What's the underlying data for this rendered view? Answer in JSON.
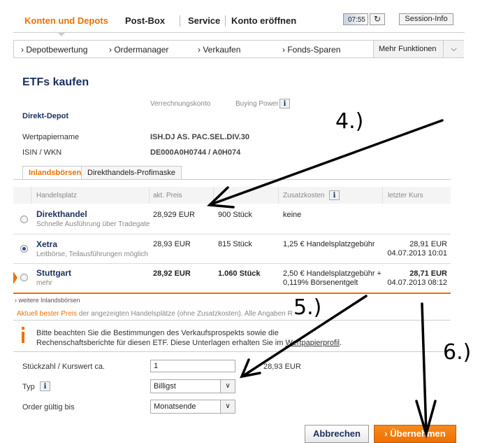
{
  "topnav": {
    "items": [
      "Konten und Depots",
      "Post-Box",
      "Service",
      "Konto eröffnen"
    ],
    "timer": "07:55",
    "reload_icon": "↻",
    "session_label": "Session-Info"
  },
  "subnav": {
    "items": [
      "› Depotbewertung",
      "› Ordermanager",
      "› Verkaufen",
      "› Fonds-Sparen"
    ],
    "more_label": "Mehr Funktionen",
    "more_icon": "⌵"
  },
  "page": {
    "title": "ETFs kaufen",
    "verrechnungskonto_label": "Verrechnungskonto",
    "buying_power_label": "Buying Power",
    "depot_label": "Direkt-Depot",
    "wertpapier_label": "Wertpapiername",
    "wertpapier_value": "ISH.DJ AS. PAC.SEL.DIV.30",
    "isin_label": "ISIN / WKN",
    "isin_value": "DE000A0H0744 / A0H074",
    "info_glyph": "i"
  },
  "tabs": [
    "Inlandsbörsen",
    "Direkthandels-Profimaske"
  ],
  "table": {
    "headers": [
      "Handelsplatz",
      "akt. Preis",
      "",
      "Zusatzkosten",
      "letzter Kurs"
    ],
    "rows": [
      {
        "name": "Direkthandel",
        "sub": "Schnelle Ausführung über Tradegate",
        "price": "28,929 EUR",
        "qty": "900 Stück",
        "cost": "keine",
        "cost2": "",
        "last": "",
        "last_date": "",
        "selected": false,
        "bold": false
      },
      {
        "name": "Xetra",
        "sub": "Leitbörse, Teilausführungen möglich",
        "price": "28,93 EUR",
        "qty": "815 Stück",
        "cost": "1,25 € Handelsplatzgebühr",
        "cost2": "",
        "last": "28,91 EUR",
        "last_date": "04.07.2013 10:01",
        "selected": true,
        "bold": false
      },
      {
        "name": "Stuttgart",
        "sub": "mehr",
        "price": "28,92 EUR",
        "qty": "1.060 Stück",
        "cost": "2,50 € Handelsplatzgebühr +",
        "cost2": "0,119% Börsenentgelt",
        "last": "28,71 EUR",
        "last_date": "04.07.2013 08:12",
        "selected": false,
        "bold": true
      }
    ],
    "more_link": "› weitere Inlandsbörsen",
    "footnote_highlight": "Aktuell bester Preis",
    "footnote_rest": " der angezeigten Handelsplätze (ohne Zusatzkosten). Alle Angaben Realtime"
  },
  "notice": {
    "line1": "Bitte beachten Sie die Bestimmungen des Verkaufsprospekts sowie die",
    "line2_pre": "Rechenschaftsberichte für diesen ETF. Diese Unterlagen erhalten Sie im ",
    "line2_link": "Wertpapierprofil",
    "line2_post": "."
  },
  "form": {
    "qty_label": "Stückzahl / Kurswert ca.",
    "qty_value": "1",
    "qty_total": "28,93 EUR",
    "typ_label": "Typ",
    "typ_value": "Billigst",
    "valid_label": "Order gültig bis",
    "valid_value": "Monatsende",
    "arrow_glyph": "∨"
  },
  "buttons": {
    "cancel": "Abbrechen",
    "ok": "› Übernehmen"
  },
  "annotations": [
    "4.)",
    "5.)",
    "6.)"
  ],
  "colors": {
    "accent": "#ee7000",
    "navy": "#1a2f5e"
  }
}
